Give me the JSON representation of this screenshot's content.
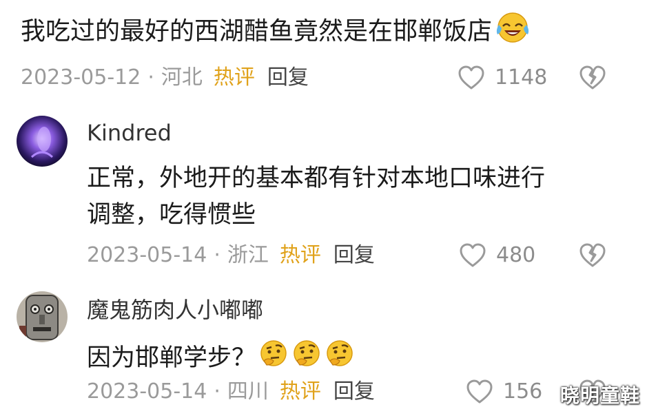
{
  "top_comment": {
    "text": "我吃过的最好的西湖醋鱼竟然是在邯郸饭店",
    "emoji": "laughing-crying-emoji",
    "date": "2023-05-12",
    "location": "河北",
    "hot_label": "热评",
    "reply_label": "回复",
    "likes": "1148"
  },
  "replies": [
    {
      "username": "Kindred",
      "avatar": "purple-glow-avatar",
      "lines": [
        "正常，外地开的基本都有针对本地口味进行",
        "调整，吃得惯些"
      ],
      "date": "2023-05-14",
      "location": "浙江",
      "hot_label": "热评",
      "reply_label": "回复",
      "likes": "480"
    },
    {
      "username": "魔鬼筋肉人小嘟嘟",
      "avatar": "grey-mask-avatar",
      "lines": [
        "因为邯郸学步？"
      ],
      "emojis": [
        "thinking-emoji",
        "thinking-emoji",
        "thinking-emoji"
      ],
      "date": "2023-05-14",
      "location": "四川",
      "hot_label": "热评",
      "reply_label": "回复",
      "likes": "156"
    }
  ],
  "separator": "·",
  "watermark": "晓明童鞋",
  "colors": {
    "hot": "#e0a21b",
    "meta": "#9a9a9a",
    "text": "#1b1b1b"
  }
}
